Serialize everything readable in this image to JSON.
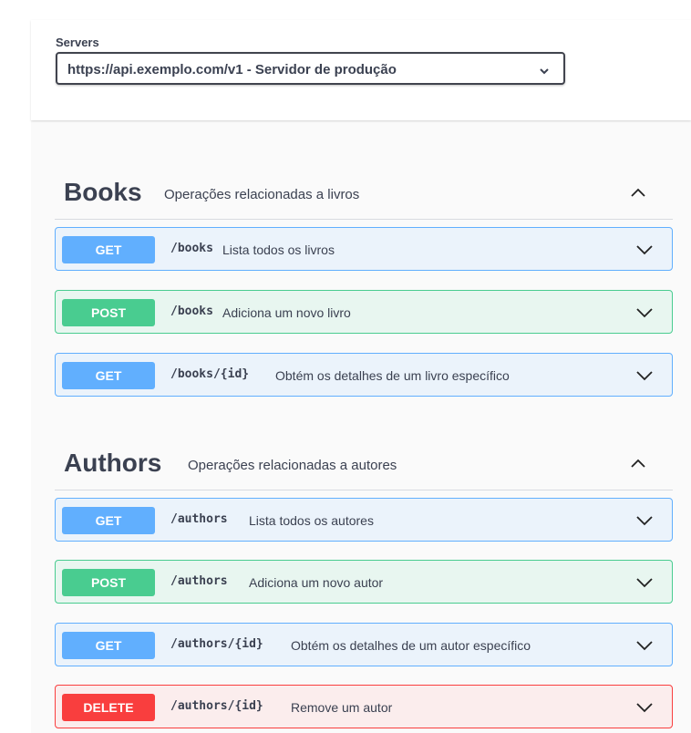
{
  "schemes": {
    "label": "Servers",
    "selected": "https://api.exemplo.com/v1 - Servidor de produção"
  },
  "tags": [
    {
      "name": "Books",
      "description": "Operações relacionadas a livros",
      "operations": [
        {
          "method": "GET",
          "path": "/books",
          "summary": "Lista todos os livros"
        },
        {
          "method": "POST",
          "path": "/books",
          "summary": "Adiciona um novo livro"
        },
        {
          "method": "GET",
          "path": "/books/{id}",
          "summary": "Obtém os detalhes de um livro específico"
        }
      ]
    },
    {
      "name": "Authors",
      "description": "Operações relacionadas a autores",
      "operations": [
        {
          "method": "GET",
          "path": "/authors",
          "summary": "Lista todos os autores"
        },
        {
          "method": "POST",
          "path": "/authors",
          "summary": "Adiciona um novo autor"
        },
        {
          "method": "GET",
          "path": "/authors/{id}",
          "summary": "Obtém os detalhes de um autor específico"
        },
        {
          "method": "DELETE",
          "path": "/authors/{id}",
          "summary": "Remove um autor"
        }
      ]
    }
  ],
  "colors": {
    "get": "#61affe",
    "post": "#49cc90",
    "delete": "#f93e3e",
    "text": "#3b4151"
  },
  "icons": {
    "select": "chevron-down-icon",
    "tag_toggle": "chevron-up-icon",
    "op_toggle": "chevron-down-icon"
  }
}
